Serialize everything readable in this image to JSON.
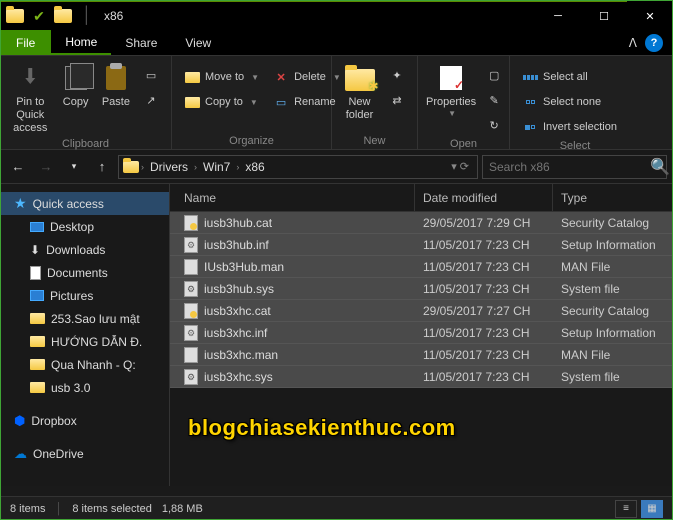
{
  "window": {
    "title": "x86"
  },
  "tabs": {
    "file": "File",
    "home": "Home",
    "share": "Share",
    "view": "View"
  },
  "ribbon": {
    "clipboard": {
      "pin": "Pin to Quick access",
      "copy": "Copy",
      "paste": "Paste",
      "group": "Clipboard"
    },
    "organize": {
      "moveto": "Move to",
      "copyto": "Copy to",
      "delete": "Delete",
      "rename": "Rename",
      "group": "Organize"
    },
    "new": {
      "newfolder": "New folder",
      "group": "New"
    },
    "open": {
      "properties": "Properties",
      "group": "Open"
    },
    "select": {
      "all": "Select all",
      "none": "Select none",
      "invert": "Invert selection",
      "group": "Select"
    }
  },
  "breadcrumbs": [
    "Drivers",
    "Win7",
    "x86"
  ],
  "search": {
    "placeholder": "Search x86"
  },
  "columns": {
    "name": "Name",
    "date": "Date modified",
    "type": "Type"
  },
  "sidebar": {
    "quickaccess": "Quick access",
    "items": [
      {
        "label": "Desktop",
        "kind": "desktop"
      },
      {
        "label": "Downloads",
        "kind": "downloads"
      },
      {
        "label": "Documents",
        "kind": "documents"
      },
      {
        "label": "Pictures",
        "kind": "pictures"
      },
      {
        "label": "253.Sao lưu mật",
        "kind": "folder"
      },
      {
        "label": "HƯỚNG DẪN Đ.",
        "kind": "folder"
      },
      {
        "label": "Qua Nhanh - Q:",
        "kind": "folder"
      },
      {
        "label": "usb 3.0",
        "kind": "folder"
      }
    ],
    "dropbox": "Dropbox",
    "onedrive": "OneDrive"
  },
  "files": [
    {
      "name": "iusb3hub.cat",
      "date": "29/05/2017 7:29 CH",
      "type": "Security Catalog",
      "ic": "cat"
    },
    {
      "name": "iusb3hub.inf",
      "date": "11/05/2017 7:23 CH",
      "type": "Setup Information",
      "ic": "inf"
    },
    {
      "name": "IUsb3Hub.man",
      "date": "11/05/2017 7:23 CH",
      "type": "MAN File",
      "ic": "man"
    },
    {
      "name": "iusb3hub.sys",
      "date": "11/05/2017 7:23 CH",
      "type": "System file",
      "ic": "sys"
    },
    {
      "name": "iusb3xhc.cat",
      "date": "29/05/2017 7:27 CH",
      "type": "Security Catalog",
      "ic": "cat"
    },
    {
      "name": "iusb3xhc.inf",
      "date": "11/05/2017 7:23 CH",
      "type": "Setup Information",
      "ic": "inf"
    },
    {
      "name": "iusb3xhc.man",
      "date": "11/05/2017 7:23 CH",
      "type": "MAN File",
      "ic": "man"
    },
    {
      "name": "iusb3xhc.sys",
      "date": "11/05/2017 7:23 CH",
      "type": "System file",
      "ic": "sys"
    }
  ],
  "status": {
    "count": "8 items",
    "selected": "8 items selected",
    "size": "1,88 MB"
  },
  "watermark": "blogchiasekienthuc.com"
}
